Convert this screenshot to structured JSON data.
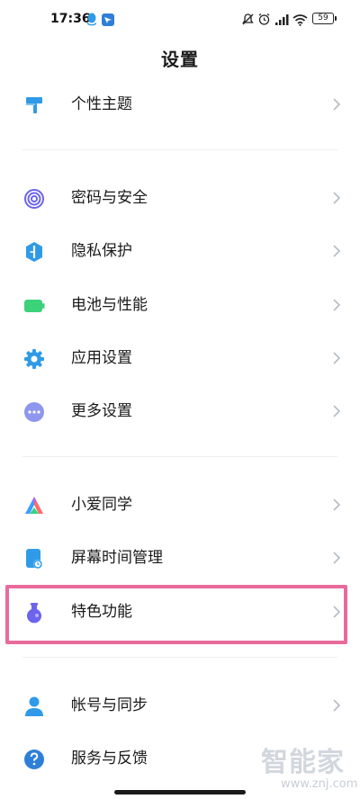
{
  "status_bar": {
    "time": "17:36",
    "battery": "59"
  },
  "header": {
    "title": "设置"
  },
  "menu": [
    {
      "label": "个性主题"
    },
    {
      "label": "密码与安全"
    },
    {
      "label": "隐私保护"
    },
    {
      "label": "电池与性能"
    },
    {
      "label": "应用设置"
    },
    {
      "label": "更多设置"
    },
    {
      "label": "小爱同学"
    },
    {
      "label": "屏幕时间管理"
    },
    {
      "label": "特色功能"
    },
    {
      "label": "帐号与同步"
    },
    {
      "label": "服务与反馈"
    }
  ],
  "watermark": {
    "text": "智能家",
    "url": "www.znj.com"
  },
  "colors": {
    "accent_blue": "#2f9be8",
    "battery_green": "#3bd27a",
    "highlight": "#e86b9c",
    "feature_purple": "#6c63ee",
    "gray": "#9aa3ad"
  }
}
